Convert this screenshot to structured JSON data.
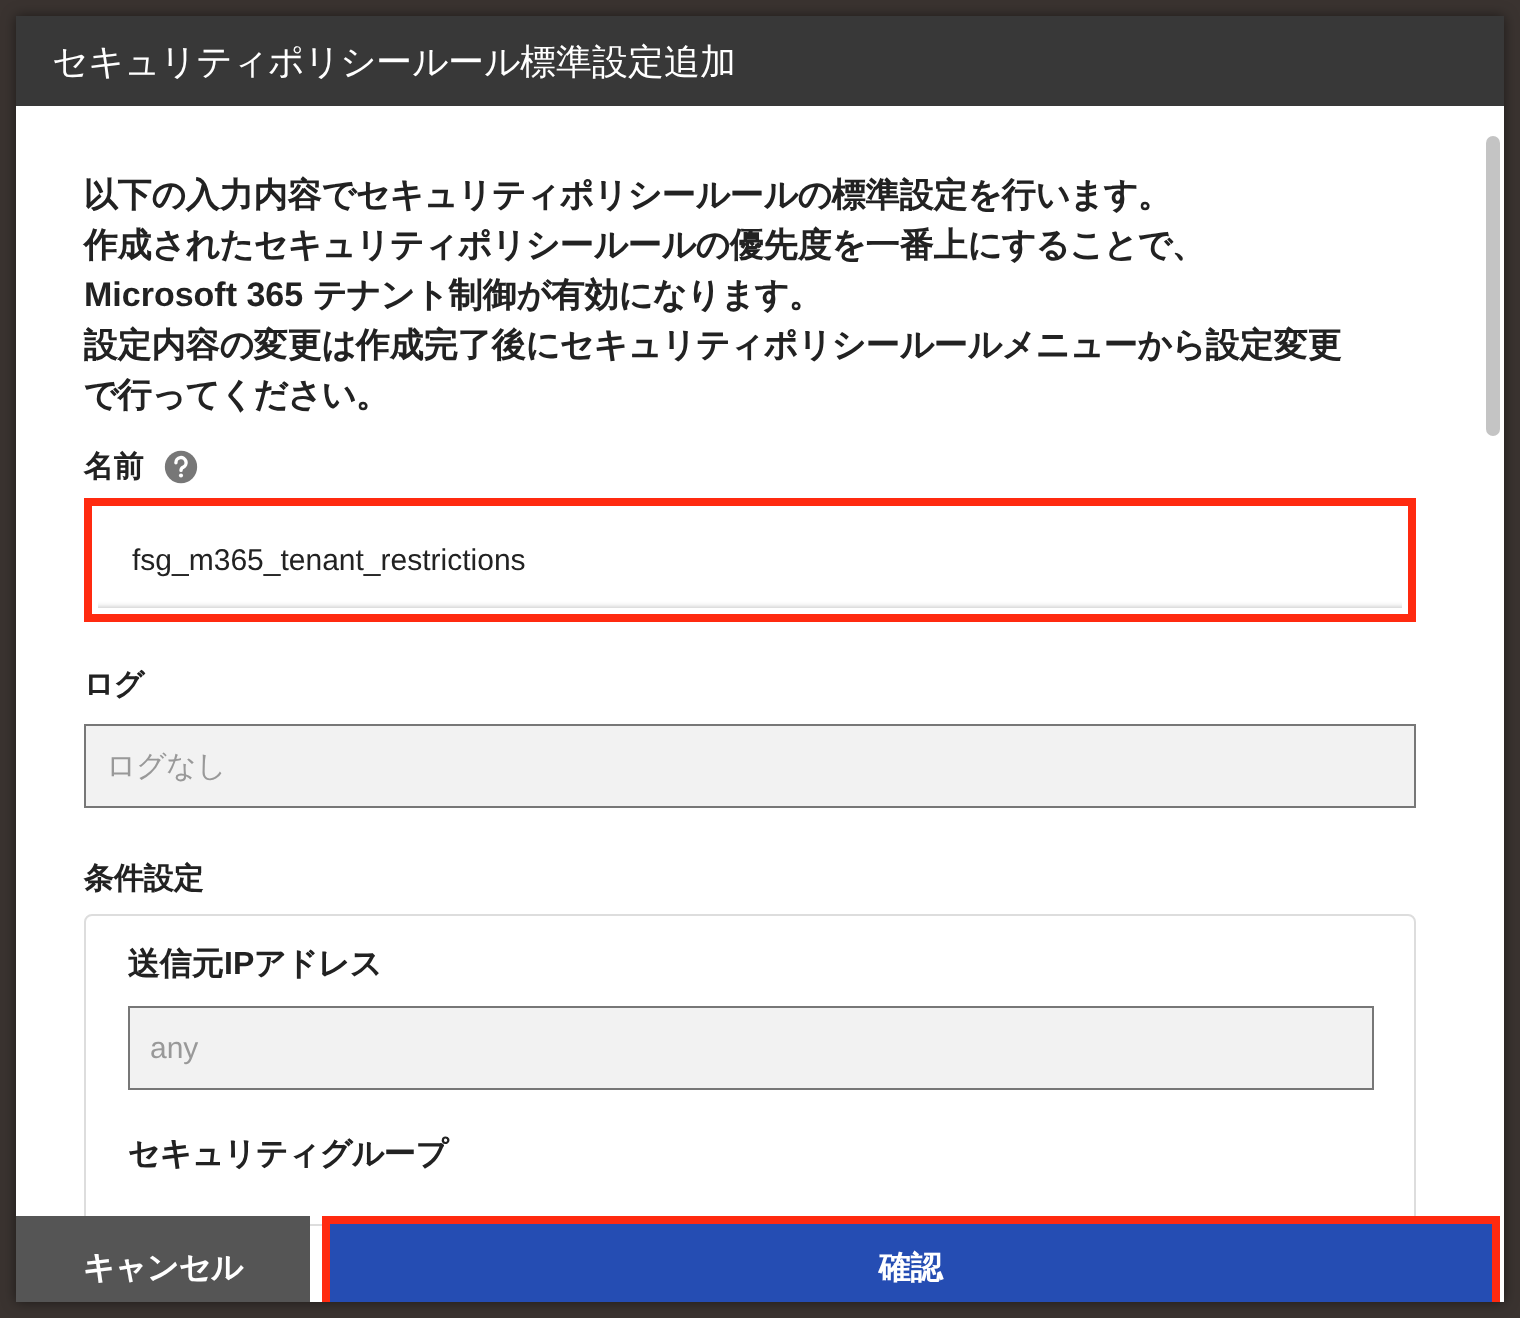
{
  "dialog": {
    "title": "セキュリティポリシールール標準設定追加",
    "description": [
      "以下の入力内容でセキュリティポリシールールの標準設定を行います。",
      "作成されたセキュリティポリシールールの優先度を一番上にすることで、",
      "Microsoft 365 テナント制御が有効になります。",
      "設定内容の変更は作成完了後にセキュリティポリシールールメニューから設定変更で行ってください。"
    ],
    "fields": [
      {
        "label": "名前",
        "help": true,
        "value": "fsg_m365_tenant_restrictions",
        "disabled": false,
        "highlighted": true
      },
      {
        "label": "ログ",
        "help": false,
        "placeholder": "ログなし",
        "disabled": true,
        "highlighted": false
      }
    ],
    "condition": {
      "label": "条件設定",
      "fields": [
        {
          "label": "送信元IPアドレス",
          "placeholder": "any",
          "disabled": true
        },
        {
          "label": "セキュリティグループ"
        }
      ]
    },
    "buttons": [
      {
        "label": "キャンセル",
        "kind": "secondary",
        "highlighted": false
      },
      {
        "label": "確認",
        "kind": "primary",
        "highlighted": true
      }
    ]
  }
}
